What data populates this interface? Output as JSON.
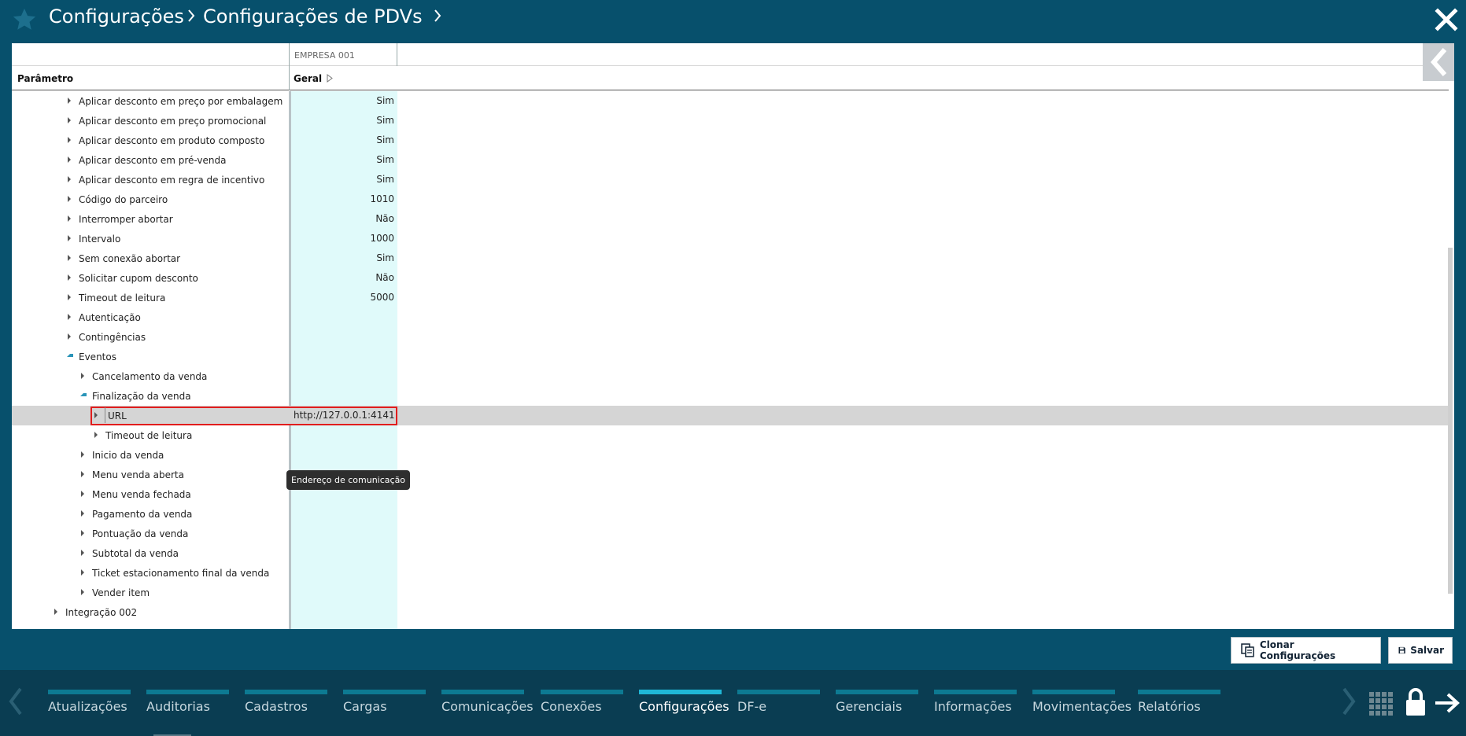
{
  "header": {
    "crumb1": "Configurações",
    "crumb2": "Configurações de PDVs"
  },
  "grid": {
    "company_column": "EMPRESA 001",
    "param_header": "Parâmetro",
    "value_header": "Geral"
  },
  "rows": [
    {
      "label": "Aplicar desconto em preço por embalagem",
      "value": "Sim"
    },
    {
      "label": "Aplicar desconto em preço promocional",
      "value": "Sim"
    },
    {
      "label": "Aplicar desconto em produto composto",
      "value": "Sim"
    },
    {
      "label": "Aplicar desconto em pré-venda",
      "value": "Sim"
    },
    {
      "label": "Aplicar desconto em regra de incentivo",
      "value": "Sim"
    },
    {
      "label": "Código do parceiro",
      "value": "1010"
    },
    {
      "label": "Interromper abortar",
      "value": "Não"
    },
    {
      "label": "Intervalo",
      "value": "1000"
    },
    {
      "label": "Sem conexão abortar",
      "value": "Sim"
    },
    {
      "label": "Solicitar cupom desconto",
      "value": "Não"
    },
    {
      "label": "Timeout de leitura",
      "value": "5000"
    },
    {
      "label": "Autenticação",
      "value": ""
    },
    {
      "label": "Contingências",
      "value": ""
    },
    {
      "label": "Eventos",
      "value": ""
    },
    {
      "label": "Cancelamento da venda",
      "value": ""
    },
    {
      "label": "Finalização da venda",
      "value": ""
    },
    {
      "label": "URL",
      "value": "http://127.0.0.1:4141"
    },
    {
      "label": "Timeout de leitura",
      "value": ""
    },
    {
      "label": "Inicio da venda",
      "value": ""
    },
    {
      "label": "Menu venda aberta",
      "value": ""
    },
    {
      "label": "Menu venda fechada",
      "value": ""
    },
    {
      "label": "Pagamento da venda",
      "value": ""
    },
    {
      "label": "Pontuação da venda",
      "value": ""
    },
    {
      "label": "Subtotal da venda",
      "value": ""
    },
    {
      "label": "Ticket estacionamento final da venda",
      "value": ""
    },
    {
      "label": "Vender item",
      "value": ""
    },
    {
      "label": "Integração 002",
      "value": ""
    }
  ],
  "tooltip": "Endereço de comunicação",
  "actions": {
    "clone": "Clonar Configurações",
    "save": "Salvar"
  },
  "nav": [
    "Atualizações",
    "Auditorias",
    "Cadastros",
    "Cargas",
    "Comunicações",
    "Conexões",
    "Configurações",
    "DF-e",
    "Gerenciais",
    "Informações",
    "Movimentações",
    "Relatórios"
  ],
  "nav_active": "Configurações",
  "colors": {
    "background": "#07506c",
    "nav_bar": "#0d7a92",
    "nav_active": "#1fb7d6",
    "value_column": "#e0fafa",
    "selected_row": "#d5d5d5",
    "highlight": "#e11d1d"
  }
}
